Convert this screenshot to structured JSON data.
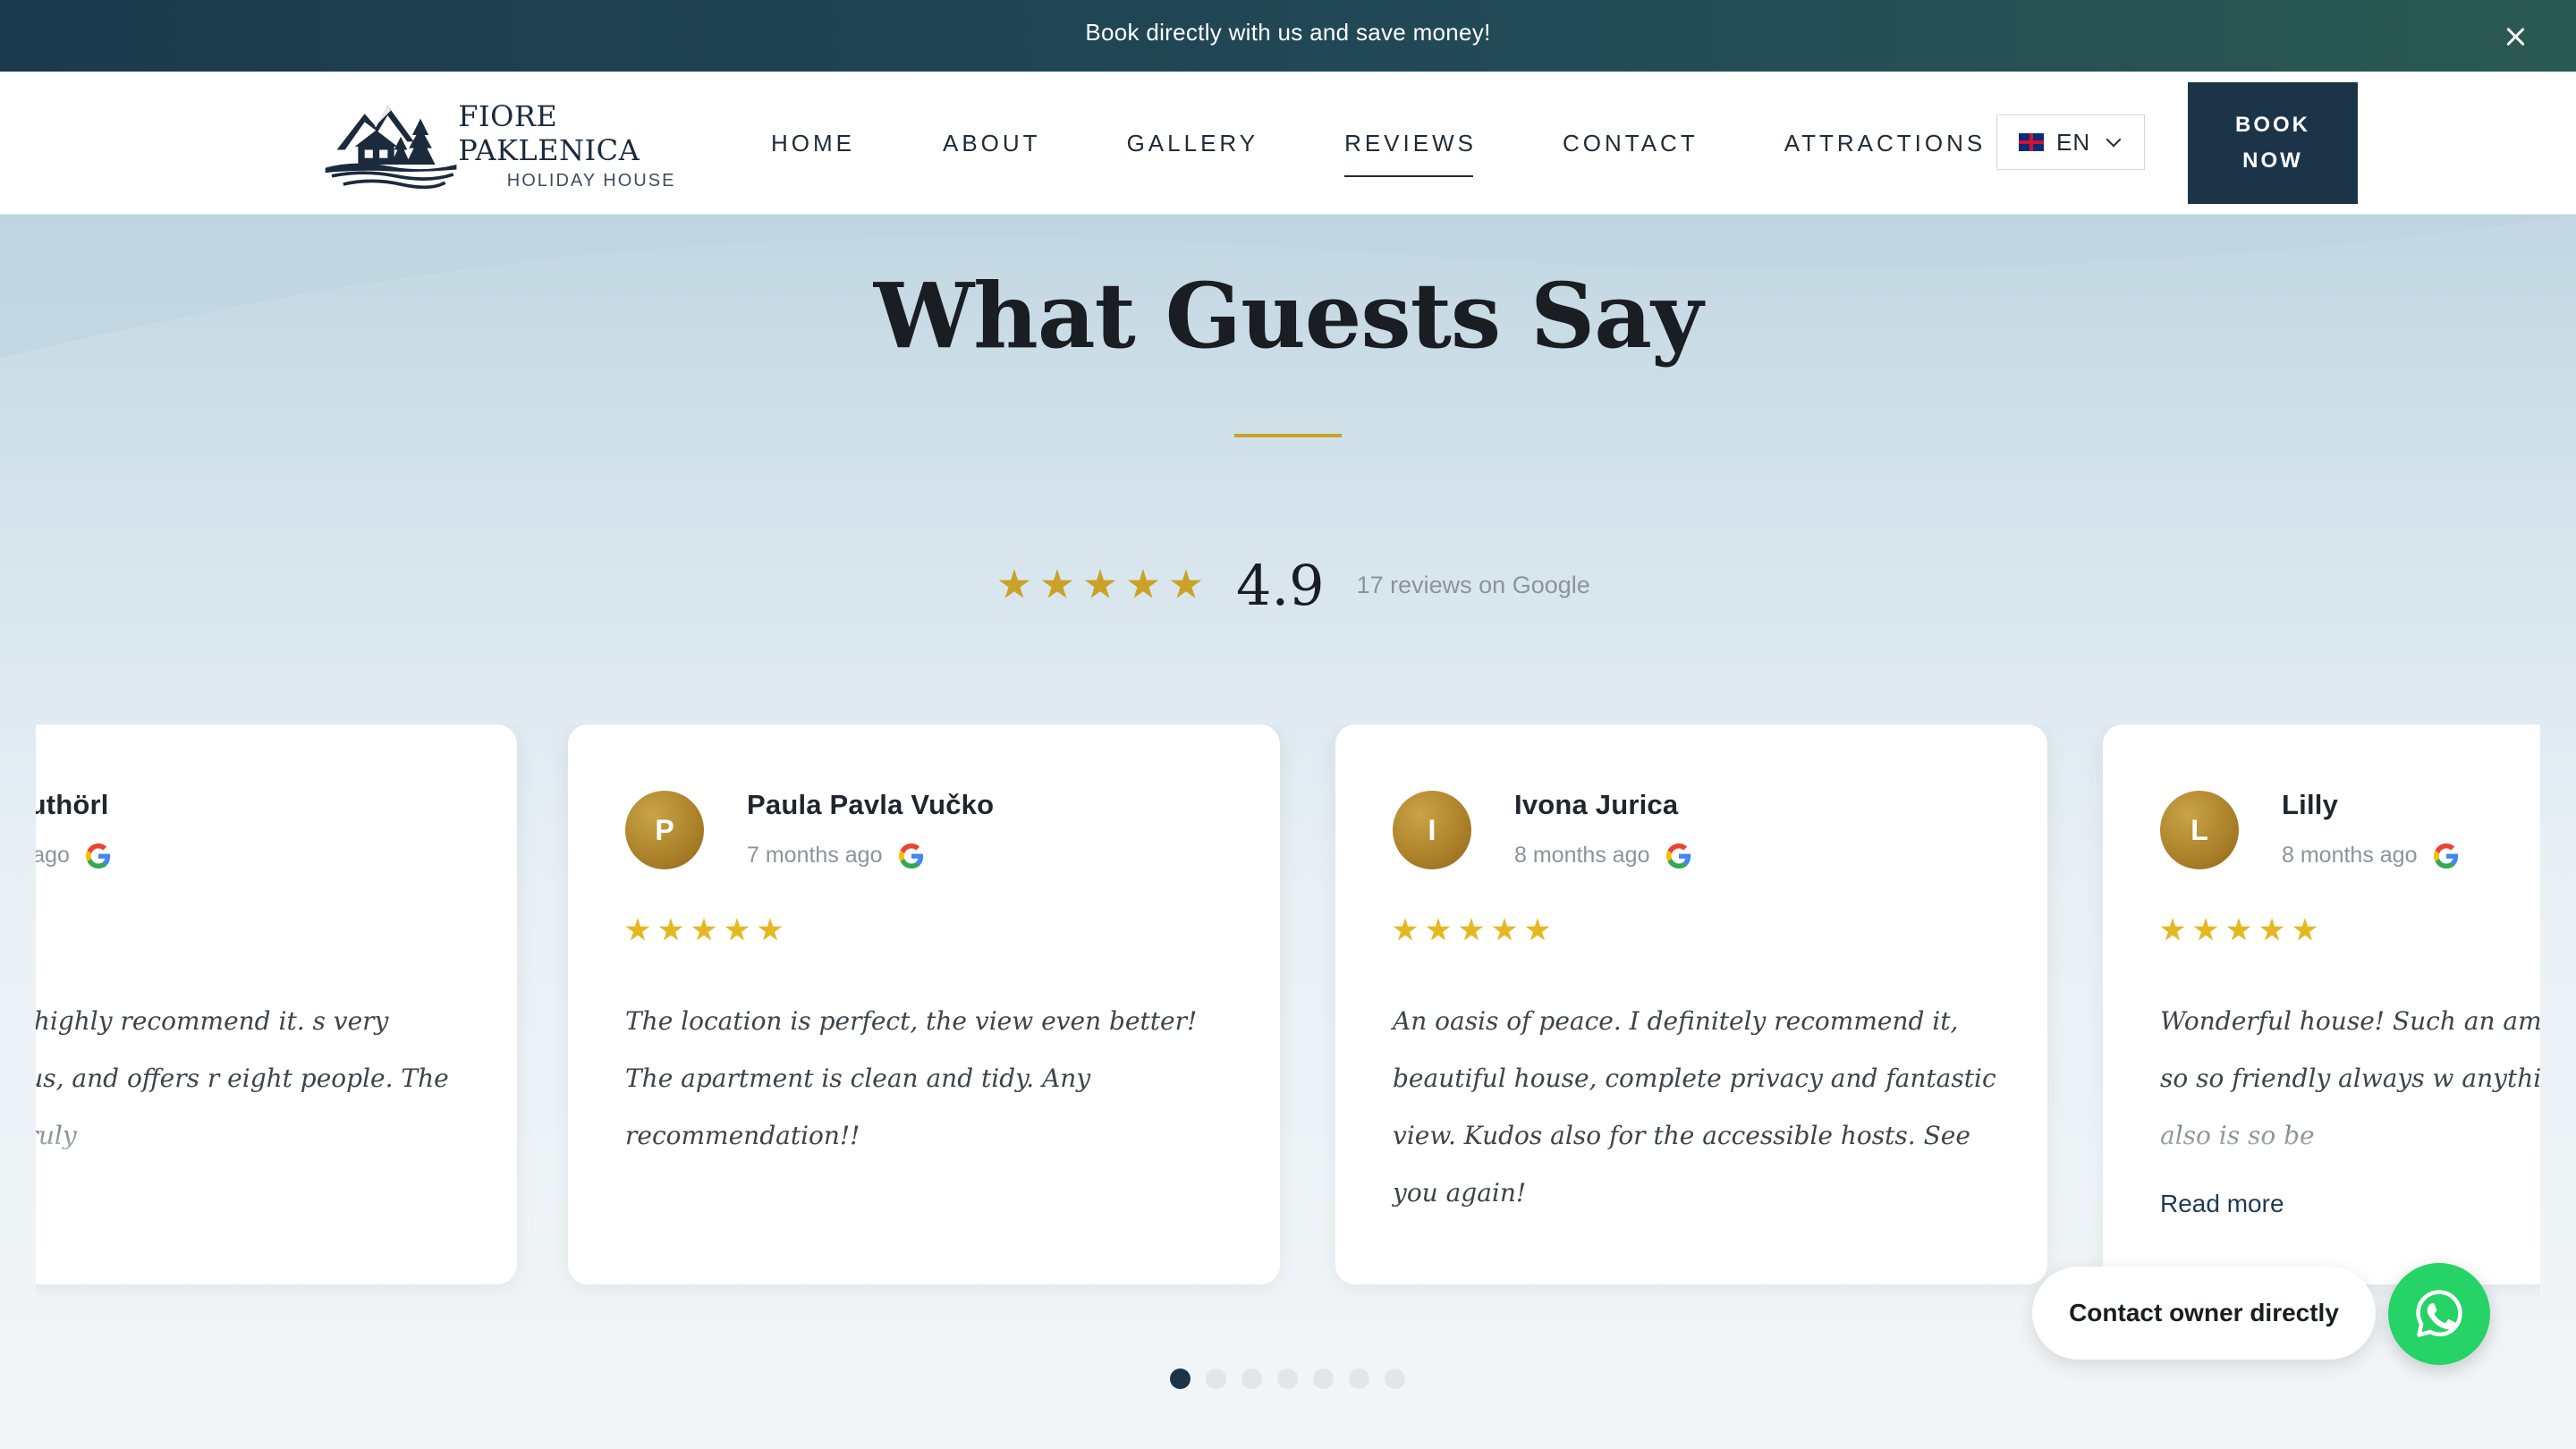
{
  "announcement": {
    "text": "Book directly with us and save money!",
    "close_icon": "close-icon"
  },
  "header": {
    "logo_name": "FIORE PAKLENICA",
    "logo_subtitle": "HOLIDAY HOUSE",
    "nav": [
      {
        "label": "HOME"
      },
      {
        "label": "ABOUT"
      },
      {
        "label": "GALLERY"
      },
      {
        "label": "REVIEWS",
        "active": true
      },
      {
        "label": "CONTACT"
      },
      {
        "label": "ATTRACTIONS"
      }
    ],
    "language": {
      "selected": "EN",
      "flag_icon": "uk-flag-icon"
    },
    "book_line1": "BOOK",
    "book_line2": "NOW"
  },
  "reviews": {
    "title": "What Guests Say",
    "rating": "4.9",
    "rating_stars": 5,
    "rating_count_text": "17 reviews on Google",
    "cards": [
      {
        "initial": "",
        "name": "a Guthörl",
        "when": "nths ago",
        "stars": 5,
        "text": "t stay here! I highly recommend it. s very clean, spacious, and offers r eight people. The view is also truly",
        "read_more": ""
      },
      {
        "initial": "P",
        "name": "Paula Pavla Vučko",
        "when": "7 months ago",
        "stars": 5,
        "text": "The location is perfect, the view even better! The apartment is clean and tidy. Any recommendation!!",
        "read_more": ""
      },
      {
        "initial": "I",
        "name": "Ivona Jurica",
        "when": "8 months ago",
        "stars": 5,
        "text": "An oasis of peace. I definitely recommend it, beautiful house, complete privacy and fantastic view. Kudos also for the accessible hosts. See you again!",
        "read_more": ""
      },
      {
        "initial": "L",
        "name": "Lilly",
        "when": "8 months ago",
        "stars": 5,
        "text": "Wonderful house! Such an amazing hosts were so so friendly always w anything! The location also is so be",
        "read_more": "Read more"
      }
    ],
    "dots_total": 7,
    "dots_active": 0
  },
  "floating": {
    "contact_label": "Contact owner directly",
    "whatsapp_icon": "whatsapp-icon"
  },
  "colors": {
    "navy": "#1c3448",
    "gold": "#c9a227",
    "star_yellow": "#e5b823",
    "whatsapp_green": "#25d366"
  }
}
